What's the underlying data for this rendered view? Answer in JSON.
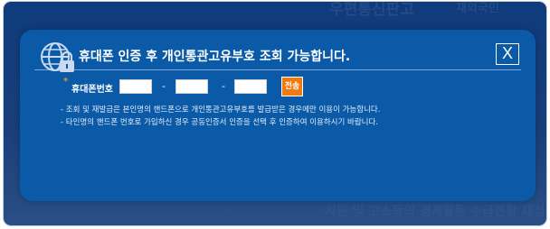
{
  "background": {
    "ghost_1": "우편통신판고",
    "ghost_2": "재외국민",
    "ghost_3": "서민 및 고소득의 경제활동 수급현황 재정"
  },
  "dialog": {
    "title": "휴대폰 인증 후 개인통관고유부호 조회 가능합니다.",
    "close_label": "X",
    "header_icon": "globe-lock-icon"
  },
  "form": {
    "required_mark": "*",
    "phone_label": "휴대폰번호",
    "phone_part1": "",
    "phone_part2": "",
    "phone_part3": "",
    "separator": "-",
    "send_label": "전송"
  },
  "notes": [
    "- 조회 및 재발급은 본인명의 핸드폰으로 개인통관고유부호를 발급받은 경우에만 이용이 가능합니다.",
    "- 타인명의 핸드폰 번호로 가입하신 경우 공동인증서 인증을 선택 후 인증하여 이용하시기 바랍니다."
  ],
  "colors": {
    "modal_bg": "#0a5aa8",
    "outer_bg": "#173f7b",
    "send_button": "#f07a10",
    "required_star": "#f08a24"
  }
}
